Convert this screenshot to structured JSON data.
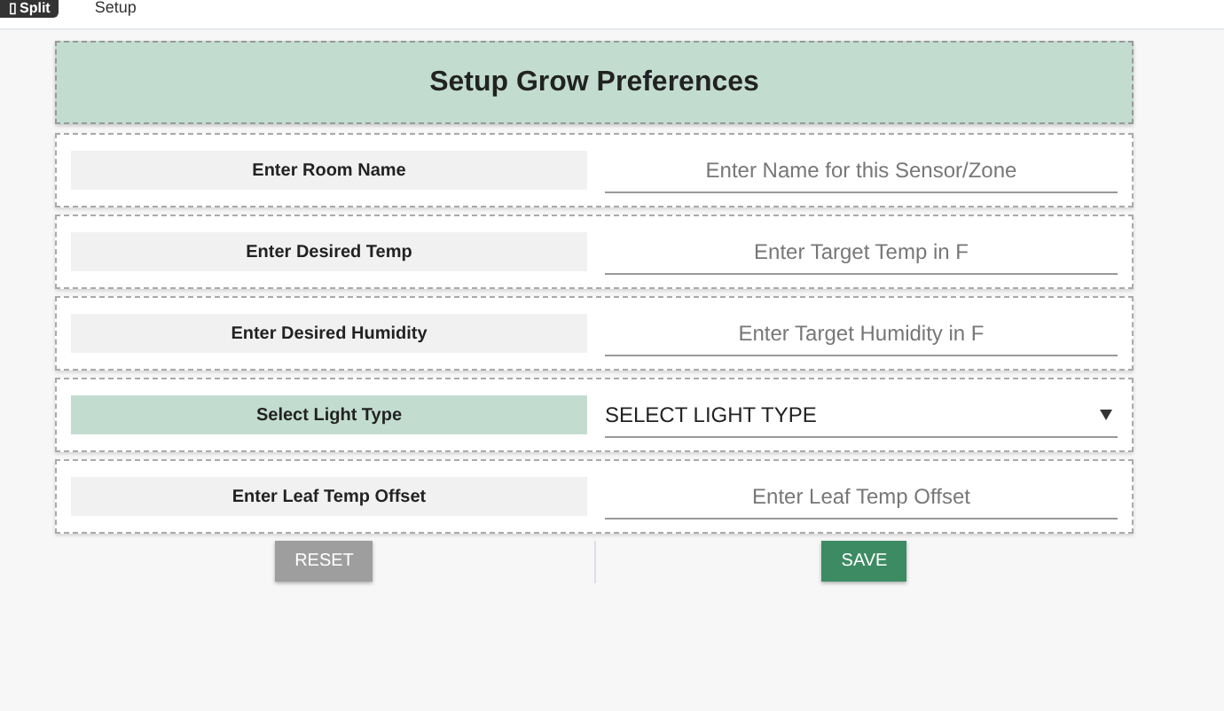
{
  "top_bar": {
    "split_button": {
      "icon": "▯",
      "label": "Split"
    },
    "tabs": [
      {
        "label": "Setup",
        "selected": false
      }
    ]
  },
  "form": {
    "title": "Setup Grow Preferences",
    "rows": [
      {
        "kind": "input",
        "label": "Enter Room Name",
        "highlighted": false,
        "placeholder": "Enter Name for this Sensor/Zone"
      },
      {
        "kind": "input",
        "label": "Enter Desired Temp",
        "highlighted": false,
        "placeholder": "Enter Target Temp in F"
      },
      {
        "kind": "input",
        "label": "Enter Desired Humidity",
        "highlighted": false,
        "placeholder": "Enter Target Humidity in F"
      },
      {
        "kind": "select",
        "label": "Select Light Type",
        "highlighted": true,
        "value": "SELECT LIGHT TYPE"
      },
      {
        "kind": "input",
        "label": "Enter Leaf Temp Offset",
        "highlighted": false,
        "placeholder": "Enter Leaf Temp Offset"
      }
    ],
    "buttons": [
      {
        "label": "RESET",
        "disabled": true
      },
      {
        "label": "SAVE",
        "disabled": false
      }
    ]
  }
}
